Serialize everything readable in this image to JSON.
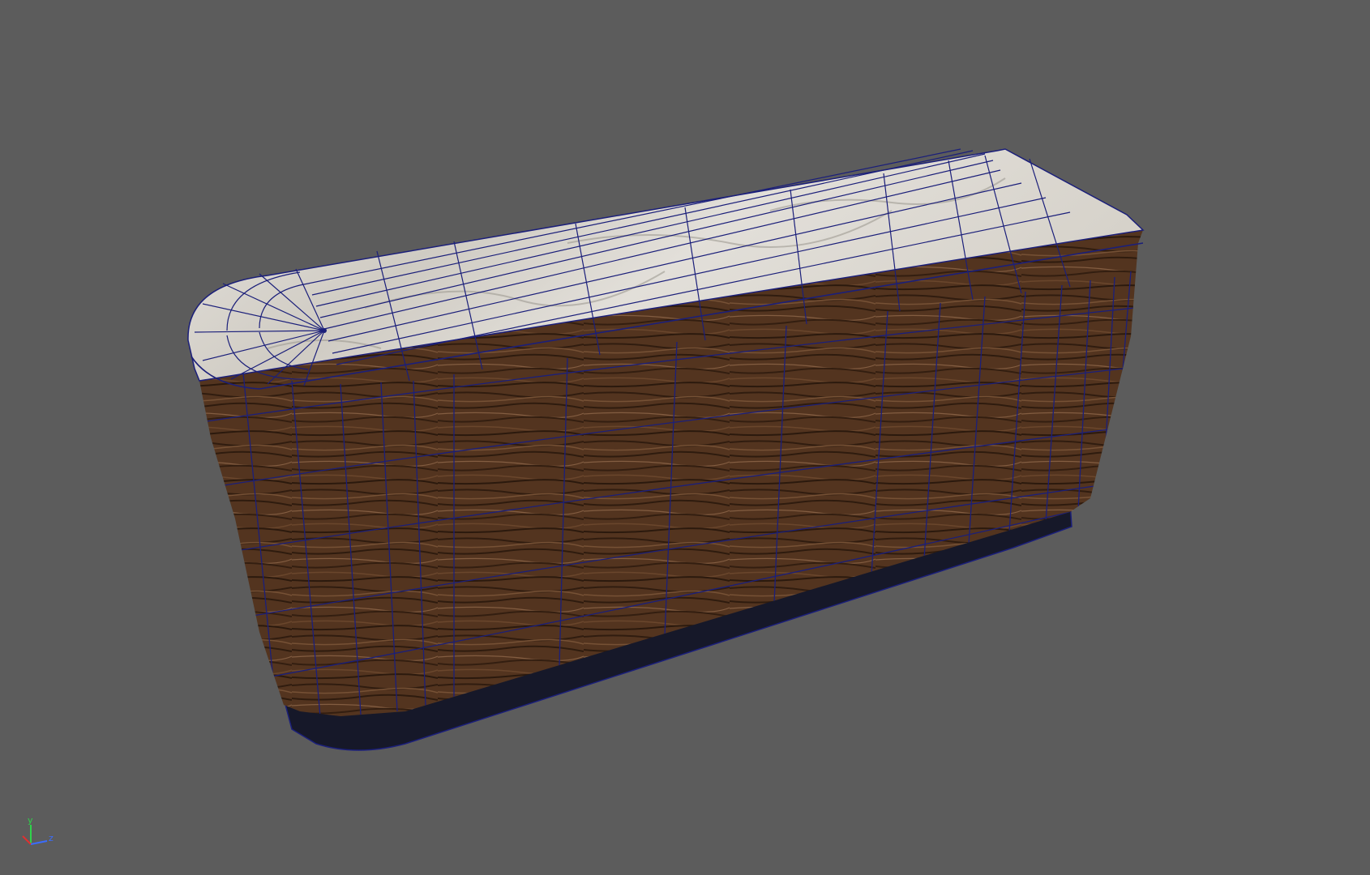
{
  "viewport": {
    "background_color": "#5c5c5c",
    "wireframe_color": "#1b1f7a",
    "wood_color": "#5a3a22",
    "marble_color": "#dcdad4",
    "base_color": "#161829"
  },
  "axis_triad": {
    "y_label": "y",
    "z_label": "z",
    "y_color": "#2fd24a",
    "z_color": "#3a6cff",
    "x_color": "#e03030"
  }
}
